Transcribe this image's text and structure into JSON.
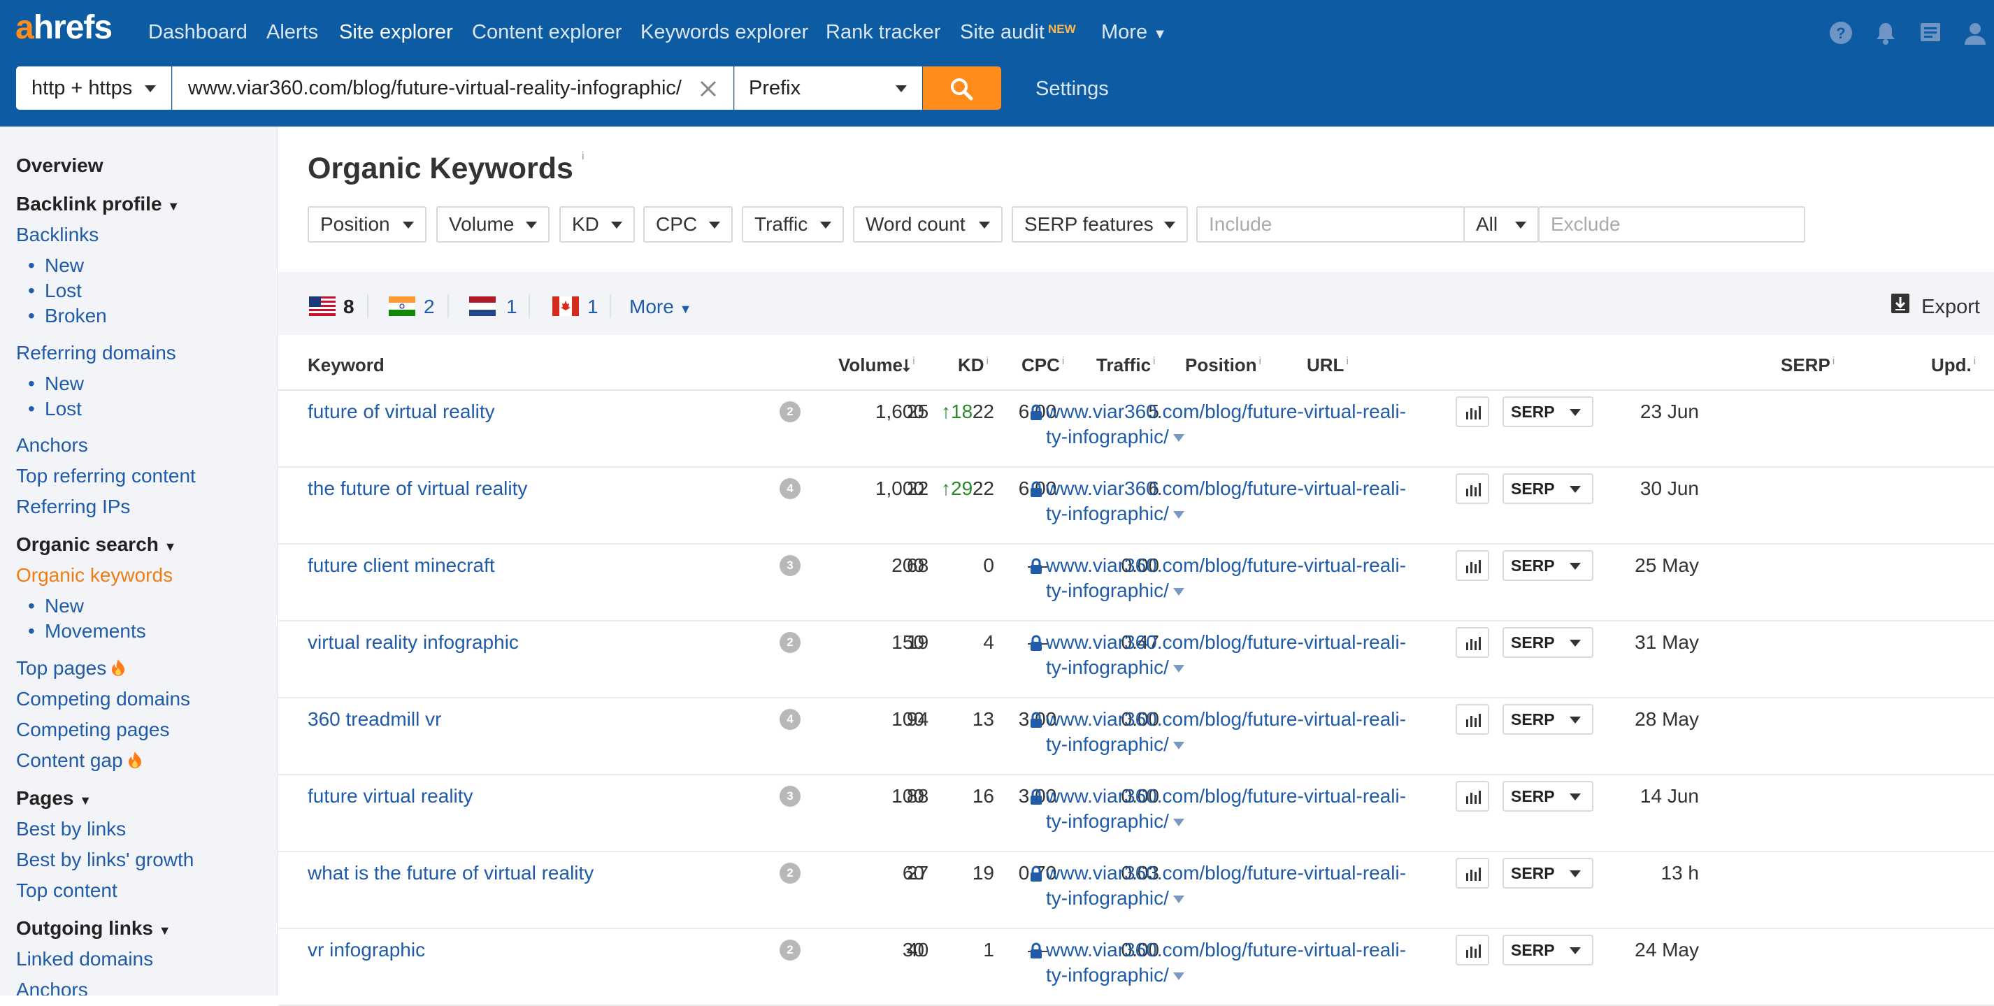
{
  "header": {
    "logo_a": "a",
    "logo_rest": "hrefs",
    "nav": [
      "Dashboard",
      "Alerts",
      "Site explorer",
      "Content explorer",
      "Keywords explorer",
      "Rank tracker",
      "Site audit",
      "More"
    ],
    "new_tag": "NEW",
    "protocol": "http + https",
    "target": "www.viar360.com/blog/future-virtual-reality-infographic/",
    "mode": "Prefix",
    "settings": "Settings"
  },
  "sidebar": {
    "overview": "Overview",
    "backlink_profile": "Backlink profile",
    "backlinks": "Backlinks",
    "bl_new": "New",
    "bl_lost": "Lost",
    "bl_broken": "Broken",
    "referring_domains": "Referring domains",
    "rd_new": "New",
    "rd_lost": "Lost",
    "anchors": "Anchors",
    "top_referring_content": "Top referring content",
    "referring_ips": "Referring IPs",
    "organic_search": "Organic search",
    "organic_keywords": "Organic keywords",
    "ok_new": "New",
    "ok_movements": "Movements",
    "top_pages": "Top pages",
    "competing_domains": "Competing domains",
    "competing_pages": "Competing pages",
    "content_gap": "Content gap",
    "pages": "Pages",
    "best_by_links": "Best by links",
    "best_by_links_growth": "Best by links' growth",
    "top_content": "Top content",
    "outgoing_links": "Outgoing links",
    "linked_domains": "Linked domains",
    "anchors2": "Anchors"
  },
  "main": {
    "title": "Organic Keywords",
    "title_info": "i",
    "filters": [
      "Position",
      "Volume",
      "KD",
      "CPC",
      "Traffic",
      "Word count",
      "SERP features"
    ],
    "include_placeholder": "Include",
    "all": "All",
    "exclude_placeholder": "Exclude",
    "countries": [
      {
        "flag": "us",
        "count": "8"
      },
      {
        "flag": "in",
        "count": "2"
      },
      {
        "flag": "nl",
        "count": "1"
      },
      {
        "flag": "ca",
        "count": "1"
      }
    ],
    "more": "More",
    "export": "Export",
    "columns": {
      "keyword": "Keyword",
      "volume": "Volume",
      "kd": "KD",
      "cpc": "CPC",
      "traffic": "Traffic",
      "position": "Position",
      "url": "URL",
      "serp": "SERP",
      "upd": "Upd."
    },
    "info": "i",
    "rows": [
      {
        "keyword": "future of virtual reality",
        "words": "2",
        "volume": "1,600",
        "kd": "22",
        "cpc": "6.00",
        "traffic": "5",
        "position": "25",
        "change": "18",
        "url1": "www.viar360.com/blog/future-virtual-reali-",
        "url2": "ty-infographic/",
        "serp": "SERP",
        "upd": "23 Jun"
      },
      {
        "keyword": "the future of virtual reality",
        "words": "4",
        "volume": "1,000",
        "kd": "22",
        "cpc": "6.00",
        "traffic": "6",
        "position": "22",
        "change": "29",
        "url1": "www.viar360.com/blog/future-virtual-reali-",
        "url2": "ty-infographic/",
        "serp": "SERP",
        "upd": "30 Jun"
      },
      {
        "keyword": "future client minecraft",
        "words": "3",
        "volume": "200",
        "kd": "0",
        "cpc": "—",
        "traffic": "0.00",
        "position": "68",
        "change": "",
        "url1": "www.viar360.com/blog/future-virtual-reali-",
        "url2": "ty-infographic/",
        "serp": "SERP",
        "upd": "25 May"
      },
      {
        "keyword": "virtual reality infographic",
        "words": "2",
        "volume": "150",
        "kd": "4",
        "cpc": "—",
        "traffic": "0.47",
        "position": "19",
        "change": "",
        "url1": "www.viar360.com/blog/future-virtual-reali-",
        "url2": "ty-infographic/",
        "serp": "SERP",
        "upd": "31 May"
      },
      {
        "keyword": "360 treadmill vr",
        "words": "4",
        "volume": "100",
        "kd": "13",
        "cpc": "3.00",
        "traffic": "0.00",
        "position": "94",
        "change": "",
        "url1": "www.viar360.com/blog/future-virtual-reali-",
        "url2": "ty-infographic/",
        "serp": "SERP",
        "upd": "28 May"
      },
      {
        "keyword": "future virtual reality",
        "words": "3",
        "volume": "100",
        "kd": "16",
        "cpc": "3.00",
        "traffic": "0.00",
        "position": "88",
        "change": "",
        "url1": "www.viar360.com/blog/future-virtual-reali-",
        "url2": "ty-infographic/",
        "serp": "SERP",
        "upd": "14 Jun"
      },
      {
        "keyword": "what is the future of virtual reality",
        "words": "2",
        "volume": "60",
        "kd": "19",
        "cpc": "0.70",
        "traffic": "0.03",
        "position": "27",
        "change": "",
        "url1": "www.viar360.com/blog/future-virtual-reali-",
        "url2": "ty-infographic/",
        "serp": "SERP",
        "upd": "13 h"
      },
      {
        "keyword": "vr infographic",
        "words": "2",
        "volume": "30",
        "kd": "1",
        "cpc": "—",
        "traffic": "0.00",
        "position": "40",
        "change": "",
        "url1": "www.viar360.com/blog/future-virtual-reali-",
        "url2": "ty-infographic/",
        "serp": "SERP",
        "upd": "24 May"
      }
    ]
  },
  "colors": {
    "topbar": "#0d5ba2",
    "accent": "#ff8c1a",
    "link": "#1f5ba8",
    "active_sidebar": "#f07c14",
    "position_up": "#2a8a2a"
  },
  "icons": [
    "help-icon",
    "bell-icon",
    "notes-icon",
    "user-icon",
    "search-icon",
    "close-icon",
    "fire-icon",
    "lock-icon",
    "chart-icon",
    "export-icon"
  ]
}
